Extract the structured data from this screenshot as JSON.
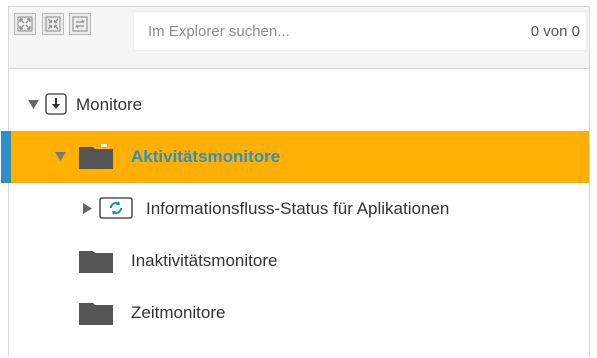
{
  "toolbar": {
    "buttons": [
      {
        "name": "expand-all-icon"
      },
      {
        "name": "collapse-all-icon"
      },
      {
        "name": "sync-icon"
      }
    ],
    "search": {
      "placeholder": "Im Explorer suchen...",
      "value": "",
      "match_count": "0 von 0"
    }
  },
  "tree": {
    "nodes": [
      {
        "label": "Monitore",
        "icon": "download-box-icon",
        "expanded": true,
        "level": 0
      },
      {
        "label": "Aktivitätsmonitore",
        "icon": "folder-icon",
        "expanded": true,
        "selected": true,
        "level": 1
      },
      {
        "label": "Informationsfluss-Status für Aplikationen",
        "icon": "refresh-box-icon",
        "expanded": false,
        "level": 2
      },
      {
        "label": "Inaktivitätsmonitore",
        "icon": "folder-icon",
        "level": 1
      },
      {
        "label": "Zeitmonitore",
        "icon": "folder-icon",
        "level": 1
      }
    ]
  },
  "colors": {
    "selected_row": "#ffb000",
    "selected_text": "#2f8fc8",
    "selection_marker": "#2f8fc8",
    "folder": "#555555"
  }
}
